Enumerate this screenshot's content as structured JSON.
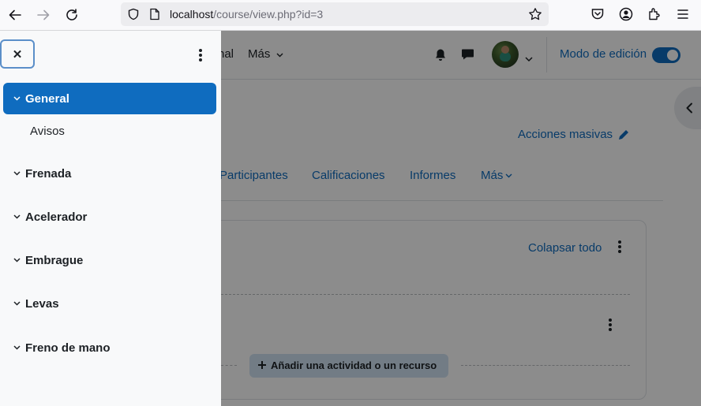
{
  "browser": {
    "url_host": "localhost",
    "url_path": "/course/view.php?id=3"
  },
  "topnav": {
    "partial_link": "nal",
    "more_label": "Más",
    "edit_mode_label": "Modo de edición"
  },
  "course": {
    "bulk_actions_label": "Acciones masivas",
    "tabs": [
      {
        "label": "Participantes"
      },
      {
        "label": "Calificaciones"
      },
      {
        "label": "Informes"
      },
      {
        "label": "Más"
      }
    ],
    "collapse_all_label": "Colapsar todo",
    "add_activity_label": "Añadir una actividad o un recurso"
  },
  "drawer": {
    "close_glyph": "✕",
    "sections": [
      {
        "label": "General",
        "active": true
      },
      {
        "label": "Frenada"
      },
      {
        "label": "Acelerador"
      },
      {
        "label": "Embrague"
      },
      {
        "label": "Levas"
      },
      {
        "label": "Freno de mano"
      }
    ],
    "general_items": [
      {
        "label": "Avisos"
      }
    ]
  },
  "colors": {
    "accent": "#0f6cbf",
    "drawer_bg": "#f8f9fa"
  }
}
